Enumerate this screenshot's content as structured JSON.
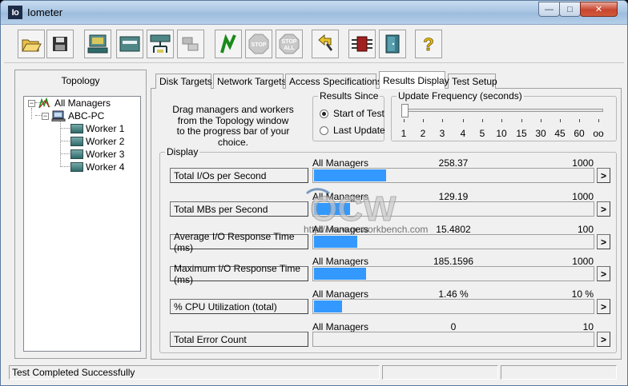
{
  "window": {
    "title": "Iometer",
    "icon_text": "Io"
  },
  "toolbar": {
    "buttons": [
      {
        "name": "open-config-icon"
      },
      {
        "name": "save-config-icon"
      },
      {
        "name": "start-disk-worker-icon"
      },
      {
        "name": "start-network-worker-icon"
      },
      {
        "name": "duplicate-worker-icon"
      },
      {
        "name": "disconnect-manager-icon"
      },
      {
        "name": "start-tests-icon"
      },
      {
        "name": "stop-icon",
        "label": "STOP"
      },
      {
        "name": "stop-all-icon",
        "label_top": "STOP",
        "label_bottom": "ALL"
      },
      {
        "name": "reset-workers-icon"
      },
      {
        "name": "exit-icon"
      },
      {
        "name": "about-icon",
        "label": "?"
      }
    ]
  },
  "topology": {
    "title": "Topology",
    "root": "All Managers",
    "manager": "ABC-PC",
    "workers": [
      "Worker 1",
      "Worker 2",
      "Worker 3",
      "Worker 4"
    ]
  },
  "tabs": [
    "Disk Targets",
    "Network Targets",
    "Access Specifications",
    "Results Display",
    "Test Setup"
  ],
  "active_tab": "Results Display",
  "instructions": [
    "Drag managers and workers",
    "from the Topology window",
    "to the progress bar of your choice."
  ],
  "results_since": {
    "title": "Results Since",
    "options": [
      "Start of Test",
      "Last Update"
    ],
    "selected": "Start of Test"
  },
  "update_frequency": {
    "title": "Update Frequency (seconds)",
    "ticks": [
      "1",
      "2",
      "3",
      "4",
      "5",
      "10",
      "15",
      "30",
      "45",
      "60",
      "oo"
    ],
    "selected_index": 0
  },
  "display": {
    "title": "Display",
    "rows": [
      {
        "metric": "Total I/Os per Second",
        "source": "All Managers",
        "value": "258.37",
        "max": "1000",
        "fraction": 0.258
      },
      {
        "metric": "Total MBs per Second",
        "source": "All Managers",
        "value": "129.19",
        "max": "1000",
        "fraction": 0.129
      },
      {
        "metric": "Average I/O Response Time (ms)",
        "source": "All Managers",
        "value": "15.4802",
        "max": "100",
        "fraction": 0.155
      },
      {
        "metric": "Maximum I/O Response Time (ms)",
        "source": "All Managers",
        "value": "185.1596",
        "max": "1000",
        "fraction": 0.185
      },
      {
        "metric": "% CPU Utilization (total)",
        "source": "All Managers",
        "value": "1.46 %",
        "max": "10 %",
        "fraction": 0.1
      },
      {
        "metric": "Total Error Count",
        "source": "All Managers",
        "value": "0",
        "max": "10",
        "fraction": 0
      }
    ],
    "arrow": ">"
  },
  "watermark": {
    "logo": "OCW",
    "url": "http://www.ocworkbench.com"
  },
  "status": {
    "text": "Test Completed Successfully"
  },
  "colors": {
    "bar": "#3399ff",
    "worker_icon": "#2f6a6a"
  }
}
